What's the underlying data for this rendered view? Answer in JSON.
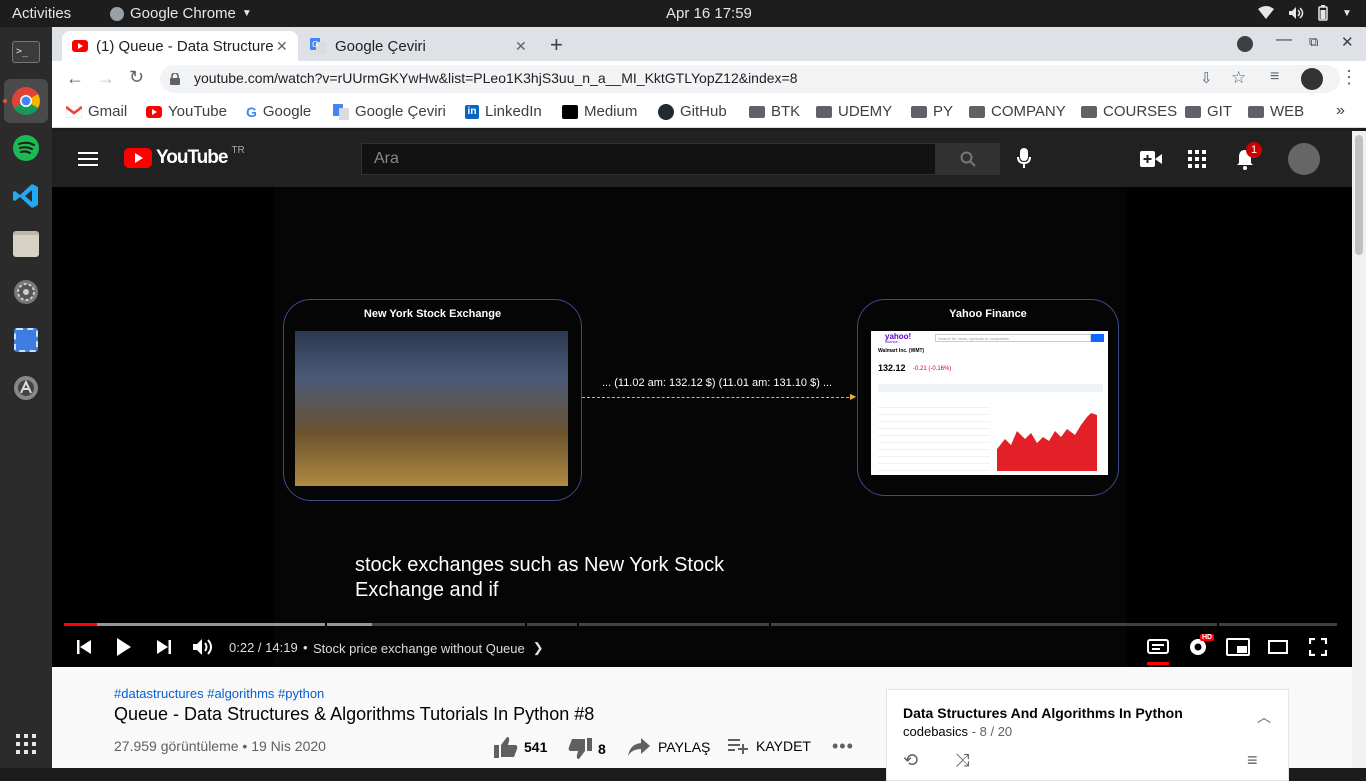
{
  "os": {
    "activities": "Activities",
    "app_name": "Google Chrome",
    "clock": "Apr 16  17:59"
  },
  "browser": {
    "tabs": [
      {
        "label": "(1) Queue - Data Structure",
        "active": true
      },
      {
        "label": "Google Çeviri",
        "active": false
      }
    ],
    "url": "youtube.com/watch?v=rUUrmGKYwHw&list=PLeo1K3hjS3uu_n_a__MI_KktGTLYopZ12&index=8",
    "bookmarks": [
      {
        "label": "Gmail",
        "icon": "gmail-icon"
      },
      {
        "label": "YouTube",
        "icon": "youtube-icon"
      },
      {
        "label": "Google",
        "icon": "google-icon"
      },
      {
        "label": "Google Çeviri",
        "icon": "translate-icon"
      },
      {
        "label": "LinkedIn",
        "icon": "linkedin-icon"
      },
      {
        "label": "Medium",
        "icon": "medium-icon"
      },
      {
        "label": "GitHub",
        "icon": "github-icon"
      },
      {
        "label": "BTK",
        "icon": "folder-icon"
      },
      {
        "label": "UDEMY",
        "icon": "folder-icon"
      },
      {
        "label": "PY",
        "icon": "folder-icon"
      },
      {
        "label": "COMPANY",
        "icon": "folder-icon"
      },
      {
        "label": "COURSES",
        "icon": "folder-icon"
      },
      {
        "label": "GIT",
        "icon": "folder-icon"
      },
      {
        "label": "WEB",
        "icon": "folder-icon"
      }
    ],
    "more_bookmarks": "»"
  },
  "youtube": {
    "logo_text": "YouTube",
    "region": "TR",
    "search_placeholder": "Ara",
    "notification_count": "1"
  },
  "video": {
    "left_box_title": "New York Stock Exchange",
    "right_box_title": "Yahoo Finance",
    "data_stream": "... (11.02 am: 132.12 $) (11.01 am: 131.10 $)  ...",
    "caption_line1": "stock exchanges such as New York Stock",
    "caption_line2": "Exchange and if",
    "yahoo": {
      "logo": "yahoo!",
      "logo_sub": "finance",
      "search_placeholder": "Search for news, symbols or companies",
      "company": "Walmart Inc. (WMT)",
      "price": "132.12",
      "change": "-0.21 (-0.16%)"
    }
  },
  "controls": {
    "time": "0:22 / 14:19",
    "separator": "•",
    "chapter": "Stock price exchange without Queue",
    "progress": 0.026,
    "buffered": 0.242,
    "hd_badge": "HD"
  },
  "details": {
    "hashtags": "#datastructures #algorithms #python",
    "title": "Queue - Data Structures & Algorithms Tutorials In Python #8",
    "views": "27.959 görüntüleme • 19 Nis 2020",
    "likes": "541",
    "dislikes": "8",
    "share": "PAYLAŞ",
    "save": "KAYDET"
  },
  "playlist": {
    "title": "Data Structures And Algorithms In Python",
    "channel": "codebasics",
    "position": "8 / 20"
  }
}
